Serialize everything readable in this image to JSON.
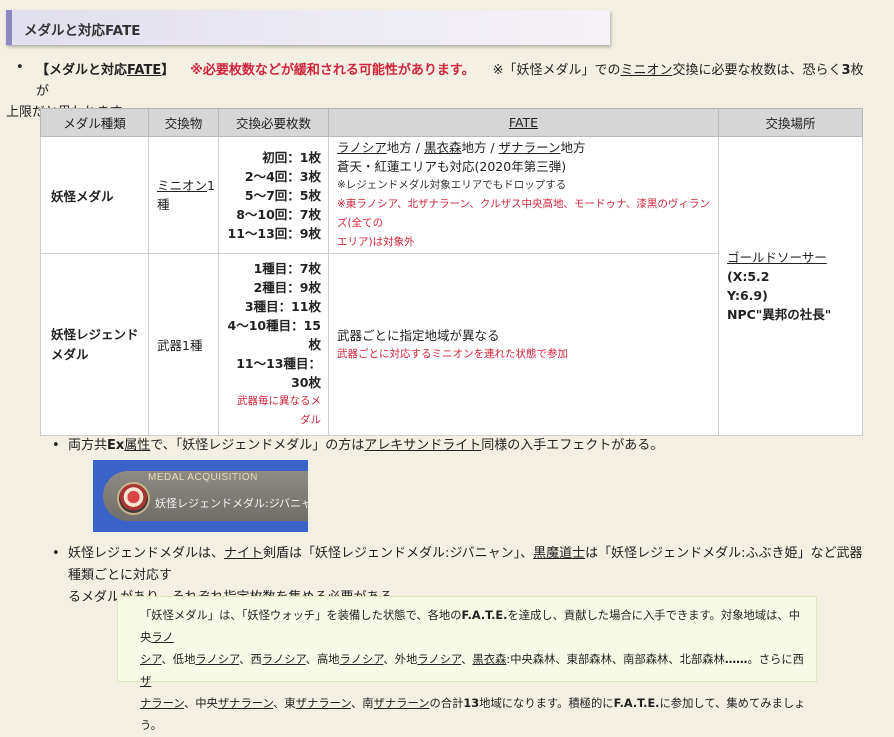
{
  "header": {
    "title": "メダルと対応FATE"
  },
  "intro": {
    "bracket_open": "【",
    "title": "メダルと対応",
    "title_link": "FATE",
    "bracket_close": "】",
    "warning": "※必要枚数などが緩和される可能性があります。",
    "note_pre": "※「妖怪メダル」での",
    "note_link": "ミニオン",
    "note_mid": "交換に必要な枚数は、恐らく",
    "note_bold": "3",
    "note_post": "枚が",
    "line2": "上限だと思われます。"
  },
  "table": {
    "headers": [
      "メダル種類",
      "交換物",
      "交換必要枚数",
      "FATE",
      "交換場所"
    ],
    "row1": {
      "type": "妖怪メダル",
      "item_link": "ミニオン",
      "item_num": "1",
      "item_line2": "種",
      "counts": [
        "初回：1枚",
        "2〜4回：3枚",
        "5〜7回：5枚",
        "8〜10回：7枚",
        "11〜13回：9枚"
      ],
      "fate": {
        "area1": "ラノシア",
        "area1_suffix": "地方 / ",
        "area2": "黒衣森",
        "area2_suffix": "地方 / ",
        "area3": "ザナラーン",
        "area3_suffix": "地方",
        "line2": "蒼天・紅蓮エリアも対応(2020年第三弾)",
        "line3": "※レジェンドメダル対象エリアでもドロップする",
        "line4": "※東ラノシア、北ザナラーン、クルザス中央高地、モードゥナ、漆黒のヴィランズ(全ての",
        "line5": "エリア)は対象外"
      }
    },
    "row2": {
      "type": "妖怪レジェンドメダル",
      "item": "武器1種",
      "counts": [
        "1種目：7枚",
        "2種目：9枚",
        "3種目：11枚",
        "4〜10種目：15",
        "枚",
        "11〜13種目：",
        "30枚"
      ],
      "counts_note1": "武器毎に異なるメ",
      "counts_note2": "ダル",
      "fate_line1": "武器ごとに指定地域が異なる",
      "fate_line2": "武器ごとに対応するミニオンを連れた状態で参加"
    },
    "location": {
      "link": "ゴールドソーサー",
      "coord1": "(X:5.2",
      "coord2": "Y:6.9)",
      "npc": "NPC\"異邦の社長\""
    }
  },
  "bullet2": {
    "pre": "両方共",
    "bold": "Ex",
    "link1": "属性",
    "mid": "で、「妖怪レジェンドメダル」の方は",
    "link2": "アレキサンドライト",
    "post": "同様の入手エフェクトがある。"
  },
  "acquisition": {
    "title": "MEDAL ACQUISITION",
    "name": "妖怪レジェンドメダル:ジバニャン"
  },
  "bullet3": {
    "pre": "妖怪レジェンドメダルは、",
    "link1": "ナイト",
    "mid1": "剣盾は「妖怪レジェンドメダル:ジバニャン」、",
    "link2": "黒魔道士",
    "mid2": "は「妖怪レジェンドメダル:ふぶき姫」など武器種類ごとに対応す",
    "line2": "るメダルがあり、それぞれ指定枚数を集める必要がある。"
  },
  "quote": {
    "l1_a": "「妖怪メダル」は、「妖怪ウォッチ」を装備した状態で、各地の",
    "l1_b": "F.A.T.E.",
    "l1_c": "を達成し、貢献した場合に入手できます。対象地域は、中央",
    "l1_link": "ラノ",
    "l2_link0": "シア",
    "l2_a": "、低地",
    "l2_link1": "ラノシア",
    "l2_b": "、西",
    "l2_link2": "ラノシア",
    "l2_c": "、高地",
    "l2_link3": "ラノシア",
    "l2_d": "、外地",
    "l2_link4": "ラノシア",
    "l2_e": "、",
    "l2_link5": "黒衣森",
    "l2_f": ":中央森林、東部森林、南部森林、北部森林",
    "l2_g": "……",
    "l2_h": "。さらに西",
    "l2_link6": "ザ",
    "l3_link0": "ナラーン",
    "l3_a": "、中央",
    "l3_link1": "ザナラーン",
    "l3_b": "、東",
    "l3_link2": "ザナラーン",
    "l3_c": "、南",
    "l3_link3": "ザナラーン",
    "l3_d": "の合計",
    "l3_e": "13",
    "l3_f": "地域になります。積極的に",
    "l3_g": "F.A.T.E.",
    "l3_h": "に参加して、集めてみましょう。"
  }
}
